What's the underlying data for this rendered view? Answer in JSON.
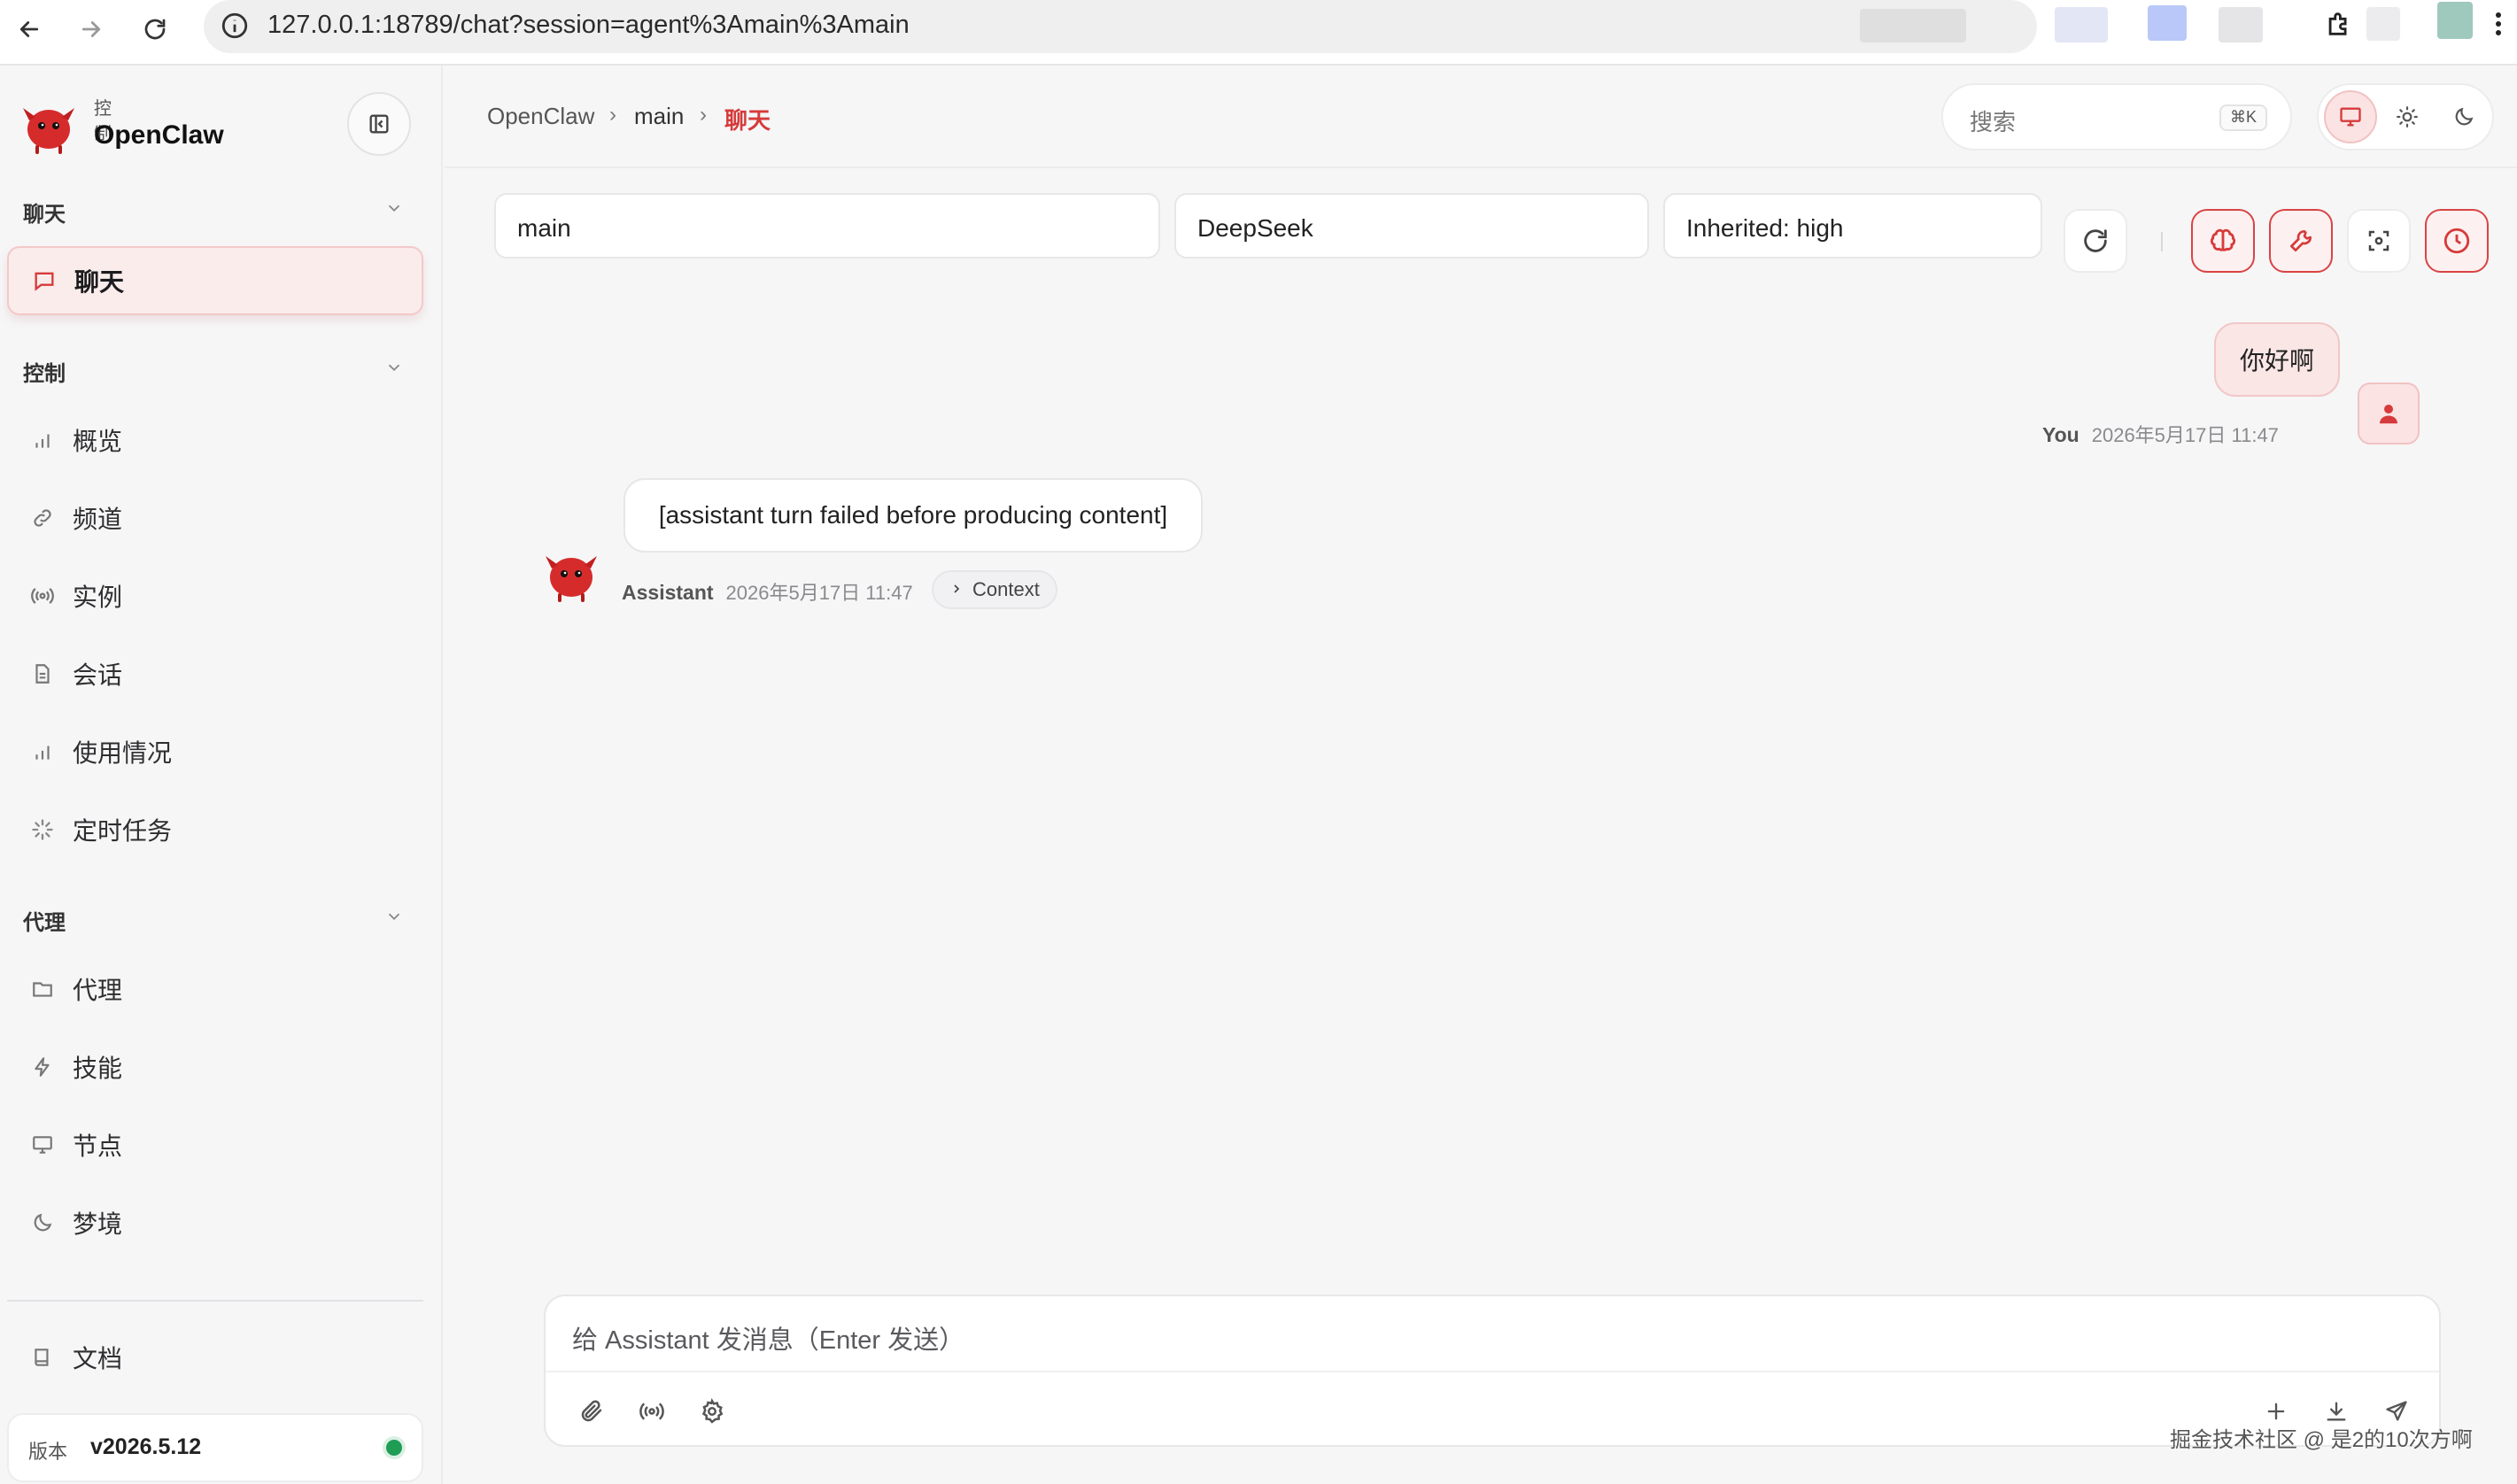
{
  "browser": {
    "url": "127.0.0.1:18789/chat?session=agent%3Amain%3Amain"
  },
  "brand": {
    "subtitle": "控制",
    "name": "OpenClaw"
  },
  "sidebar": {
    "sections": [
      {
        "label": "聊天",
        "items": [
          {
            "label": "聊天",
            "icon": "chat-bubble-icon",
            "active": true
          }
        ]
      },
      {
        "label": "控制",
        "items": [
          {
            "label": "概览",
            "icon": "bar-chart-icon"
          },
          {
            "label": "频道",
            "icon": "link-icon"
          },
          {
            "label": "实例",
            "icon": "broadcast-icon"
          },
          {
            "label": "会话",
            "icon": "document-icon"
          },
          {
            "label": "使用情况",
            "icon": "bar-chart-icon"
          },
          {
            "label": "定时任务",
            "icon": "loader-icon"
          }
        ]
      },
      {
        "label": "代理",
        "items": [
          {
            "label": "代理",
            "icon": "folder-icon"
          },
          {
            "label": "技能",
            "icon": "bolt-icon"
          },
          {
            "label": "节点",
            "icon": "monitor-icon"
          },
          {
            "label": "梦境",
            "icon": "moon-icon"
          }
        ]
      }
    ],
    "docs_label": "文档",
    "version_label": "版本",
    "version_value": "v2026.5.12"
  },
  "topbar": {
    "breadcrumb": [
      "OpenClaw",
      "main",
      "聊天"
    ],
    "breadcrumb_sep": "›",
    "search_placeholder": "搜索",
    "search_shortcut": "⌘K"
  },
  "session": {
    "agent": "main",
    "model": "DeepSeek",
    "thinking": "Inherited: high"
  },
  "messages": {
    "user": {
      "text": "你好啊",
      "sender": "You",
      "time": "2026年5月17日 11:47"
    },
    "assistant": {
      "text": "[assistant turn failed before producing content]",
      "sender": "Assistant",
      "time": "2026年5月17日 11:47",
      "context_label": "Context"
    }
  },
  "composer": {
    "placeholder": "给 Assistant 发消息（Enter 发送）"
  },
  "watermark": "掘金技术社区 @ 是2的10次方啊",
  "colors": {
    "accent": "#d63a3a",
    "accent_soft": "#fbecec",
    "status_ok": "#1f9d55"
  }
}
